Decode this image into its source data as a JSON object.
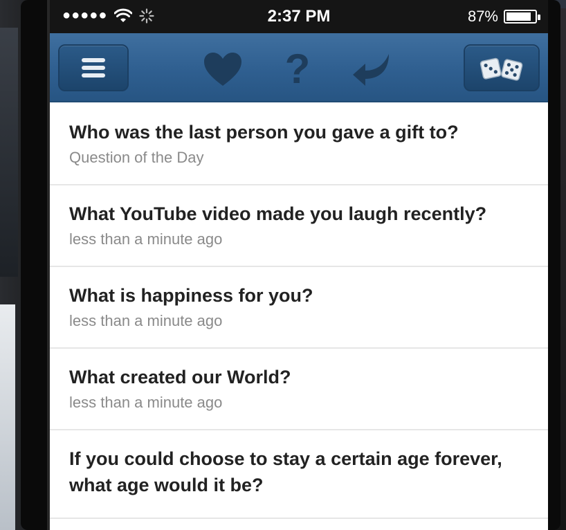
{
  "statusbar": {
    "signal": "●●●●●",
    "time": "2:37 PM",
    "battery_percent": "87%",
    "battery_level": 0.87
  },
  "navbar": {
    "icons": [
      "menu-icon",
      "heart-icon",
      "question-icon",
      "back-arrow-icon",
      "dice-icon"
    ],
    "question_glyph": "?"
  },
  "questions": [
    {
      "text": "Who was the last person you gave a gift to?",
      "meta": "Question of the Day"
    },
    {
      "text": "What YouTube video made you laugh recently?",
      "meta": "less than a minute ago"
    },
    {
      "text": "What is happiness for you?",
      "meta": "less than a minute ago"
    },
    {
      "text": "What created our World?",
      "meta": "less than a minute ago"
    },
    {
      "text": "If you could choose to stay a certain age forever, what age would it be?",
      "meta": ""
    }
  ],
  "colors": {
    "navbar": "#2f5f90",
    "icon_dark": "#1e3d5c",
    "title": "#222222",
    "meta": "#8a8a8a"
  }
}
